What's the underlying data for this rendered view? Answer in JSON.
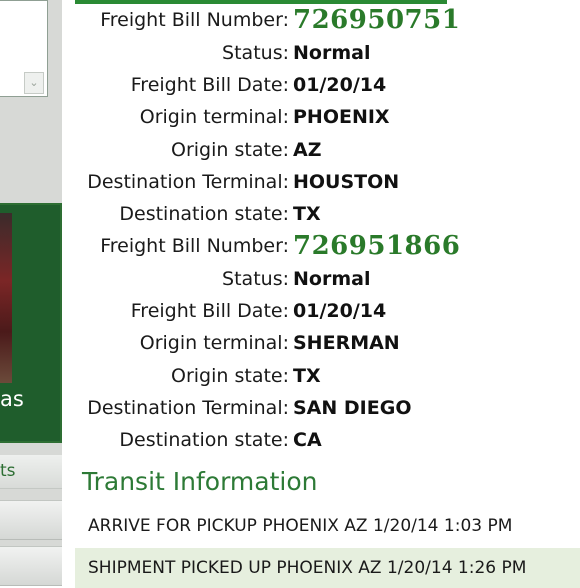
{
  "sidebar": {
    "promo_text": "as",
    "link_text": "ts"
  },
  "shipments": [
    {
      "freight_bill_number": "726950751",
      "status": "Normal",
      "freight_bill_date": "01/20/14",
      "origin_terminal": "PHOENIX",
      "origin_state": "AZ",
      "destination_terminal": "HOUSTON",
      "destination_state": "TX"
    },
    {
      "freight_bill_number": "726951866",
      "status": "Normal",
      "freight_bill_date": "01/20/14",
      "origin_terminal": "SHERMAN",
      "origin_state": "TX",
      "destination_terminal": "SAN DIEGO",
      "destination_state": "CA"
    }
  ],
  "labels": {
    "freight_bill_number": "Freight Bill Number:",
    "status": "Status:",
    "freight_bill_date": "Freight Bill Date:",
    "origin_terminal": "Origin terminal:",
    "origin_state": "Origin state:",
    "destination_terminal": "Destination Terminal:",
    "destination_state": "Destination state:"
  },
  "transit": {
    "title": "Transit Information",
    "events": [
      "ARRIVE FOR PICKUP PHOENIX AZ 1/20/14 1:03 PM",
      "SHIPMENT PICKED UP PHOENIX AZ 1/20/14 1:26 PM"
    ]
  },
  "colors": {
    "accent_green": "#2a7a2a",
    "sidebar_green": "#1f5d2c",
    "row_alt": "#e6efde"
  }
}
